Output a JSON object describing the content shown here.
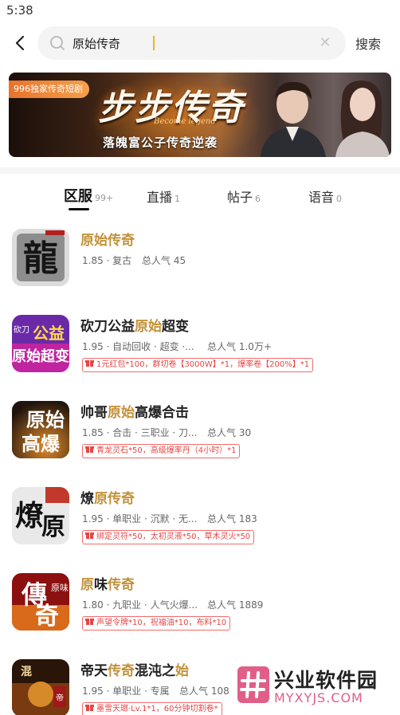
{
  "status_bar": {
    "time": "5:38"
  },
  "search": {
    "value": "原始传奇",
    "placeholder": "",
    "button_label": "搜索"
  },
  "banner": {
    "tag": "996独家传奇短剧",
    "title": "步步传奇",
    "subtitle": "Become legend",
    "slogan": "落魄富公子传奇逆袭"
  },
  "tabs": [
    {
      "label": "区服",
      "count": "99+",
      "active": true
    },
    {
      "label": "直播",
      "count": "1",
      "active": false
    },
    {
      "label": "帖子",
      "count": "6",
      "active": false
    },
    {
      "label": "语音",
      "count": "0",
      "active": false
    }
  ],
  "results": [
    {
      "name_parts": [
        {
          "t": "原始传奇",
          "hl": true
        }
      ],
      "meta": "1.85 · 复古",
      "popularity": "总人气 45",
      "gift": "",
      "icon": "dragon-game-icon"
    },
    {
      "name_parts": [
        {
          "t": "砍刀公益",
          "hl": false
        },
        {
          "t": "原始",
          "hl": true
        },
        {
          "t": "超变",
          "hl": false
        }
      ],
      "meta": "1.95 · 自动回收 · 超变 ·...",
      "popularity": "总人气 1.0万+",
      "gift": "1元红包*100，群切卷【3000W】*1，爆率卷【200%】*1",
      "icon": "knife-charity-game-icon"
    },
    {
      "name_parts": [
        {
          "t": "帅哥",
          "hl": false
        },
        {
          "t": "原始",
          "hl": true
        },
        {
          "t": "高爆合击",
          "hl": false
        }
      ],
      "meta": "1.85 · 合击 · 三职业 · 刀...",
      "popularity": "总人气 30",
      "gift": "青龙灵石*50，高级爆率丹（4小时）*1",
      "icon": "handsome-original-game-icon"
    },
    {
      "name_parts": [
        {
          "t": "燎",
          "hl": false
        },
        {
          "t": "原传奇",
          "hl": true
        }
      ],
      "meta": "1.95 · 单职业 · 沉默 · 无...",
      "popularity": "总人气 183",
      "gift": "绑定灵符*50，太初灵液*50，草木灵火*50",
      "icon": "liaoyuan-game-icon"
    },
    {
      "name_parts": [
        {
          "t": "原",
          "hl": true
        },
        {
          "t": "味",
          "hl": false
        },
        {
          "t": "传奇",
          "hl": true
        }
      ],
      "meta": "1.80 · 九职业 · 人气火爆...",
      "popularity": "总人气 1889",
      "gift": "声望令牌*10，祝福油*10，布料*10",
      "icon": "original-flavor-game-icon"
    },
    {
      "name_parts": [
        {
          "t": "帝天",
          "hl": false
        },
        {
          "t": "传奇",
          "hl": true
        },
        {
          "t": "混沌之",
          "hl": false
        },
        {
          "t": "始",
          "hl": true
        }
      ],
      "meta": "1.95 · 单职业 · 专属",
      "popularity": "总人气 108",
      "gift": "墨雪天瑯·Lv.1*1，60分钟切割卷*",
      "icon": "ditian-game-icon"
    }
  ],
  "watermark": {
    "text": "兴业软件园",
    "url": "MYXYJS.COM"
  },
  "colors": {
    "highlight": "#c39138",
    "gift_red": "#e64545",
    "caret": "#f2b418"
  }
}
